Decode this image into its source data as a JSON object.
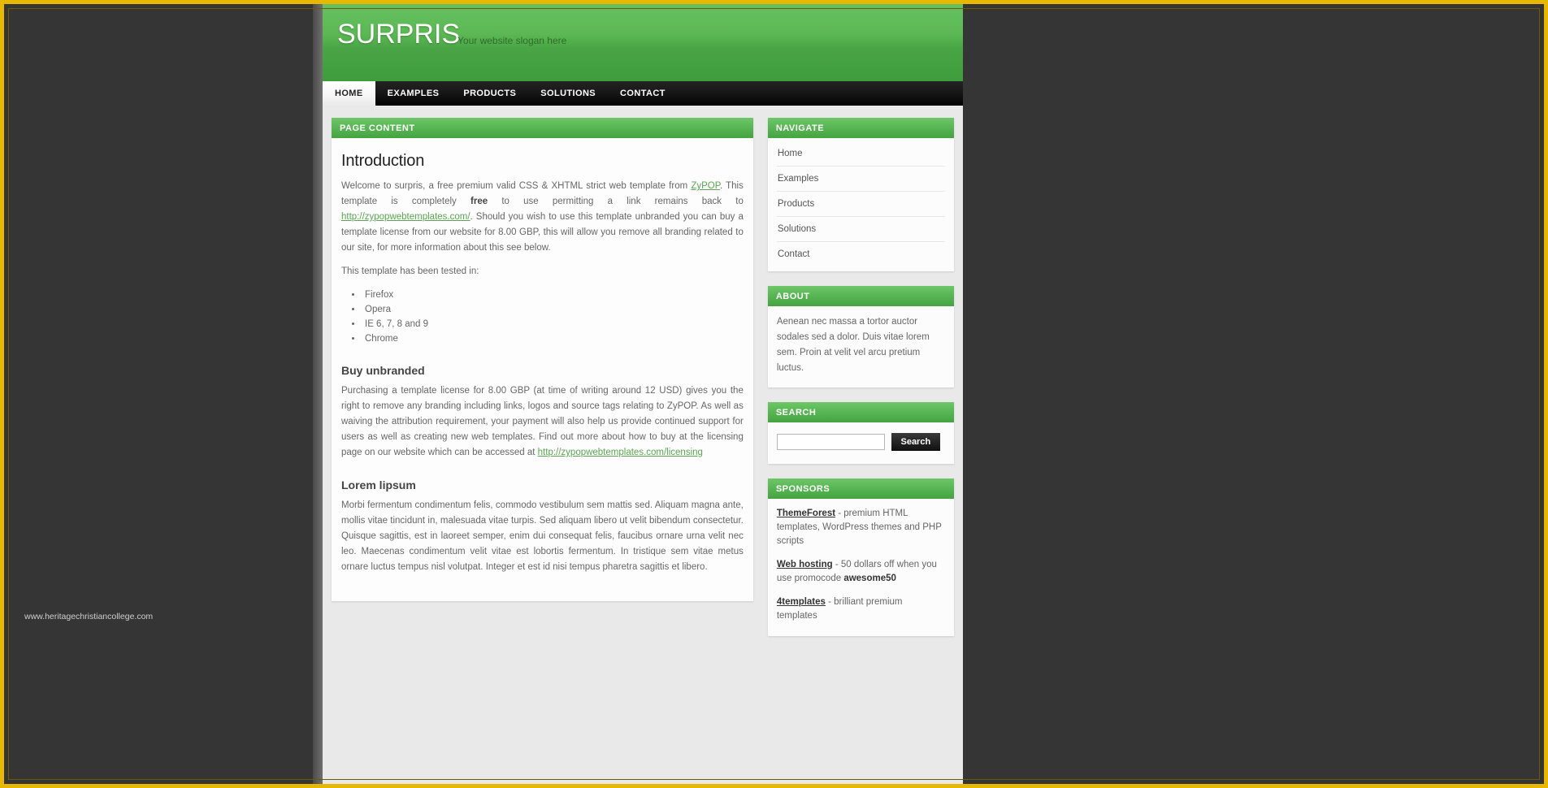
{
  "site": {
    "logo": "SURPRIS",
    "slogan": "Your website slogan here"
  },
  "nav": {
    "items": [
      {
        "label": "HOME",
        "active": true
      },
      {
        "label": "EXAMPLES",
        "active": false
      },
      {
        "label": "PRODUCTS",
        "active": false
      },
      {
        "label": "SOLUTIONS",
        "active": false
      },
      {
        "label": "CONTACT",
        "active": false
      }
    ]
  },
  "main": {
    "panel_title": "PAGE CONTENT",
    "heading": "Introduction",
    "intro_1": "Welcome to surpris, a free premium valid CSS & XHTML strict web template from ",
    "intro_link_1": "ZyPOP",
    "intro_2": ". This template is completely ",
    "intro_bold": "free",
    "intro_3": " to use permitting a link remains back to ",
    "intro_link_2": "http://zypopwebtemplates.com/",
    "intro_4": ". Should you wish to use this template unbranded you can buy a template license from our website for 8.00 GBP, this will allow you remove all branding related to our site, for more information about this see below.",
    "tested_intro": "This template has been tested in:",
    "browsers": [
      "Firefox",
      "Opera",
      "IE 6, 7, 8 and 9",
      "Chrome"
    ],
    "buy_heading": "Buy unbranded",
    "buy_text_1": "Purchasing a template license for 8.00 GBP (at time of writing around 12 USD) gives you the right to remove any branding including links, logos and source tags relating to ZyPOP. As well as waiving the attribution requirement, your payment will also help us provide continued support for users as well as creating new web templates. Find out more about how to buy at the licensing page on our website which can be accessed at ",
    "buy_link": "http://zypopwebtemplates.com/licensing",
    "lorem_heading": "Lorem lipsum",
    "lorem_text": "Morbi fermentum condimentum felis, commodo vestibulum sem mattis sed. Aliquam magna ante, mollis vitae tincidunt in, malesuada vitae turpis. Sed aliquam libero ut velit bibendum consectetur. Quisque sagittis, est in laoreet semper, enim dui consequat felis, faucibus ornare urna velit nec leo. Maecenas condimentum velit vitae est lobortis fermentum. In tristique sem vitae metus ornare luctus tempus nisl volutpat. Integer et est id nisi tempus pharetra sagittis et libero."
  },
  "sidebar": {
    "navigate": {
      "title": "NAVIGATE",
      "items": [
        "Home",
        "Examples",
        "Products",
        "Solutions",
        "Contact"
      ]
    },
    "about": {
      "title": "ABOUT",
      "text": "Aenean nec massa a tortor auctor sodales sed a dolor. Duis vitae lorem sem. Proin at velit vel arcu pretium luctus."
    },
    "search": {
      "title": "SEARCH",
      "value": "",
      "placeholder": "",
      "button": "Search"
    },
    "sponsors": {
      "title": "SPONSORS",
      "items": [
        {
          "link": "ThemeForest",
          "text": " - premium HTML templates, WordPress themes and PHP scripts",
          "bold": ""
        },
        {
          "link": "Web hosting",
          "text": " - 50 dollars off when you use promocode ",
          "bold": "awesome50"
        },
        {
          "link": "4templates",
          "text": " - brilliant premium templates",
          "bold": ""
        }
      ]
    }
  },
  "watermark": "www.heritagechristiancollege.com",
  "colors": {
    "green": "#4fae49",
    "dark": "#111111",
    "frame": "#e8b800",
    "link_green": "#5aa552"
  }
}
